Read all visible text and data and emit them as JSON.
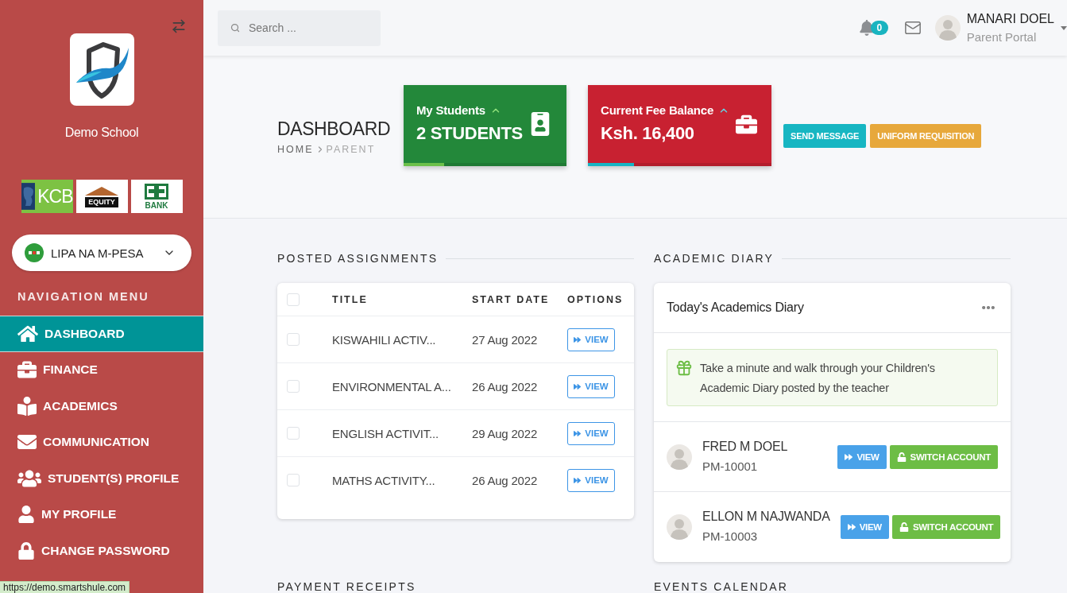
{
  "sidebar": {
    "school_name": "Demo School",
    "banks": [
      "KCB",
      "EQUITY",
      "BANK"
    ],
    "payment": {
      "label": "LIPA NA M-PESA"
    },
    "menu_title": "NAVIGATION MENU",
    "menu": [
      {
        "label": "DASHBOARD",
        "selected": true
      },
      {
        "label": "FINANCE",
        "selected": false
      },
      {
        "label": "ACADEMICS",
        "selected": false
      },
      {
        "label": "COMMUNICATION",
        "selected": false
      },
      {
        "label": "STUDENT(S) PROFILE",
        "selected": false
      },
      {
        "label": "MY PROFILE",
        "selected": false
      },
      {
        "label": "CHANGE PASSWORD",
        "selected": false
      }
    ]
  },
  "header": {
    "search": {
      "placeholder": "Search ..."
    },
    "notifications": {
      "count": "0"
    },
    "user": {
      "name": "MANARI DOEL",
      "role": "Parent Portal"
    }
  },
  "page": {
    "title": "DASHBOARD",
    "breadcrumb": [
      "HOME",
      "PARENT"
    ]
  },
  "stats": [
    {
      "title": "My Students",
      "value": "2 STUDENTS",
      "color": "#23883a",
      "level": 0.25
    },
    {
      "title": "Current Fee Balance",
      "value": "Ksh. 16,400",
      "color": "#c82131",
      "level": 0.25
    }
  ],
  "actions": [
    {
      "label": "SEND MESSAGE",
      "color": "#17b6c2"
    },
    {
      "label": "UNIFORM REQUISITION",
      "color": "#e7a83b"
    }
  ],
  "assignments": {
    "heading": "POSTED ASSIGNMENTS",
    "select_all": {
      "checked": false
    },
    "columns": [
      "TITLE",
      "START DATE",
      "OPTIONS"
    ],
    "rows": [
      {
        "title": "KISWAHILI ACTIV...",
        "start_date": "27 Aug 2022",
        "action": "VIEW",
        "checked": false
      },
      {
        "title": "ENVIRONMENTAL A...",
        "start_date": "26 Aug 2022",
        "action": "VIEW",
        "checked": false
      },
      {
        "title": "ENGLISH ACTIVIT...",
        "start_date": "29 Aug 2022",
        "action": "VIEW",
        "checked": false
      },
      {
        "title": "MATHS ACTIVITY...",
        "start_date": "26 Aug 2022",
        "action": "VIEW",
        "checked": false
      }
    ]
  },
  "diary": {
    "heading": "ACADEMIC DIARY",
    "title": "Today's Academics Diary",
    "notice": "Take a minute and walk through your Children's Academic Diary posted by the teacher",
    "students": [
      {
        "name": "FRED M DOEL",
        "admission_no": "PM-10001",
        "view": "VIEW",
        "switch": "SWITCH ACCOUNT"
      },
      {
        "name": "ELLON M NAJWANDA",
        "admission_no": "PM-10003",
        "view": "VIEW",
        "switch": "SWITCH ACCOUNT"
      }
    ]
  },
  "more_sections": [
    "PAYMENT RECEIPTS",
    "EVENTS CALENDAR"
  ],
  "status_bar": {
    "url": "https://demo.smartshule.com"
  }
}
